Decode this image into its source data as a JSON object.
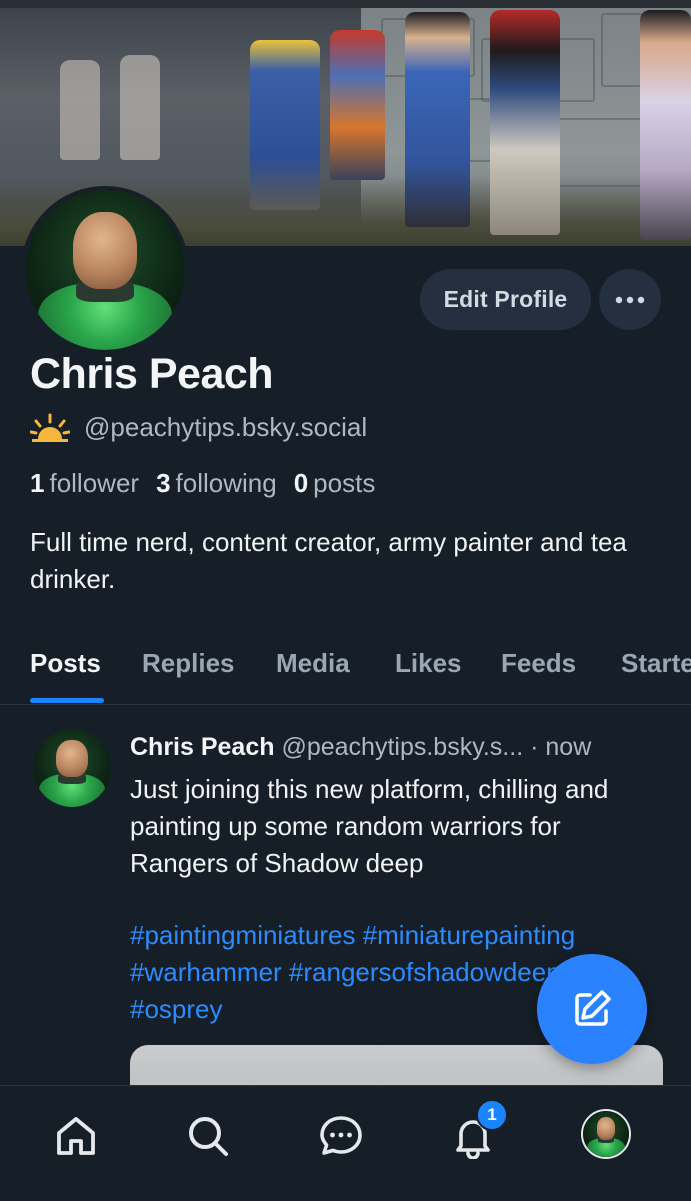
{
  "profile": {
    "display_name": "Chris Peach",
    "handle": "@peachytips.bsky.social",
    "handle_icon": "sunrise-icon",
    "edit_label": "Edit Profile",
    "more_icon": "ellipsis-icon",
    "stats": {
      "followers_count": "1",
      "followers_label": "follower",
      "following_count": "3",
      "following_label": "following",
      "posts_count": "0",
      "posts_label": "posts"
    },
    "bio": "Full time nerd, content creator, army painter and tea drinker."
  },
  "tabs": [
    "Posts",
    "Replies",
    "Media",
    "Likes",
    "Feeds",
    "Starte"
  ],
  "active_tab": "Posts",
  "post": {
    "author": "Chris Peach",
    "handle": "@peachytips.bsky.s...",
    "time": "· now",
    "text": "Just joining this new platform, chilling and painting up some random warriors for Rangers of Shadow deep",
    "tags": "#paintingminiatures #miniaturepainting #warhammer #rangersofshadowdeep #osprey"
  },
  "nav": {
    "home_icon": "home-icon",
    "search_icon": "search-icon",
    "chat_icon": "chat-icon",
    "notifications_icon": "bell-icon",
    "notifications_badge": "1",
    "profile_icon": "avatar"
  },
  "colors": {
    "background": "#161e27",
    "accent": "#1a85ff",
    "link": "#2b8cff",
    "button": "#243040"
  }
}
